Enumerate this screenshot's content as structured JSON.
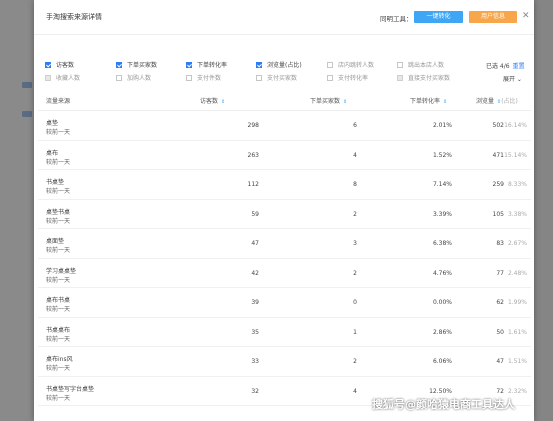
{
  "modal": {
    "title": "手淘搜索来源详情",
    "tools_label": "同明工具：",
    "convert_button": "一键转化",
    "user_info_button": "用户信息",
    "close_icon": "close-icon"
  },
  "options": {
    "row1": [
      {
        "label": "访客数",
        "checked": true
      },
      {
        "label": "下单买家数",
        "checked": true
      },
      {
        "label": "下单转化率",
        "checked": true
      },
      {
        "label": "浏览量(占比)",
        "checked": true
      },
      {
        "label": "店内跳转人数",
        "checked": false
      },
      {
        "label": "跳出本店人数",
        "checked": false
      }
    ],
    "row2": [
      {
        "label": "收藏人数",
        "checked": false,
        "grey": true
      },
      {
        "label": "加购人数",
        "checked": false
      },
      {
        "label": "支付件数",
        "checked": false
      },
      {
        "label": "支付买家数",
        "checked": false
      },
      {
        "label": "支付转化率",
        "checked": false
      },
      {
        "label": "直接支付买家数",
        "checked": false,
        "grey": true
      }
    ],
    "selected_info": "已选 4/6",
    "reset_label": "重置",
    "expand_label": "展开"
  },
  "table": {
    "headers": {
      "source": "流量来源",
      "visitors": "访客数",
      "buyers": "下单买家数",
      "rate": "下单转化率",
      "views": "浏览量",
      "share": "(占比)"
    },
    "rows": [
      {
        "keyword": "桌垫",
        "sub": "较前一天",
        "visitors": "298",
        "buyers": "6",
        "rate": "2.01%",
        "views": "502",
        "share": "16.14%"
      },
      {
        "keyword": "桌布",
        "sub": "较前一天",
        "visitors": "263",
        "buyers": "4",
        "rate": "1.52%",
        "views": "471",
        "share": "15.14%"
      },
      {
        "keyword": "书桌垫",
        "sub": "较前一天",
        "visitors": "112",
        "buyers": "8",
        "rate": "7.14%",
        "views": "259",
        "share": "8.33%"
      },
      {
        "keyword": "桌垫书桌",
        "sub": "较前一天",
        "visitors": "59",
        "buyers": "2",
        "rate": "3.39%",
        "views": "105",
        "share": "3.38%"
      },
      {
        "keyword": "桌面垫",
        "sub": "较前一天",
        "visitors": "47",
        "buyers": "3",
        "rate": "6.38%",
        "views": "83",
        "share": "2.67%"
      },
      {
        "keyword": "学习桌桌垫",
        "sub": "较前一天",
        "visitors": "42",
        "buyers": "2",
        "rate": "4.76%",
        "views": "77",
        "share": "2.48%"
      },
      {
        "keyword": "桌布书桌",
        "sub": "较前一天",
        "visitors": "39",
        "buyers": "0",
        "rate": "0.00%",
        "views": "62",
        "share": "1.99%"
      },
      {
        "keyword": "书桌桌布",
        "sub": "较前一天",
        "visitors": "35",
        "buyers": "1",
        "rate": "2.86%",
        "views": "50",
        "share": "1.61%"
      },
      {
        "keyword": "桌布ins风",
        "sub": "较前一天",
        "visitors": "33",
        "buyers": "2",
        "rate": "6.06%",
        "views": "47",
        "share": "1.51%"
      },
      {
        "keyword": "书桌垫写字台桌垫",
        "sub": "较前一天",
        "visitors": "32",
        "buyers": "4",
        "rate": "12.50%",
        "views": "72",
        "share": "2.32%"
      }
    ]
  },
  "watermark": "搜狐号@颜哈猿电商工具达人"
}
